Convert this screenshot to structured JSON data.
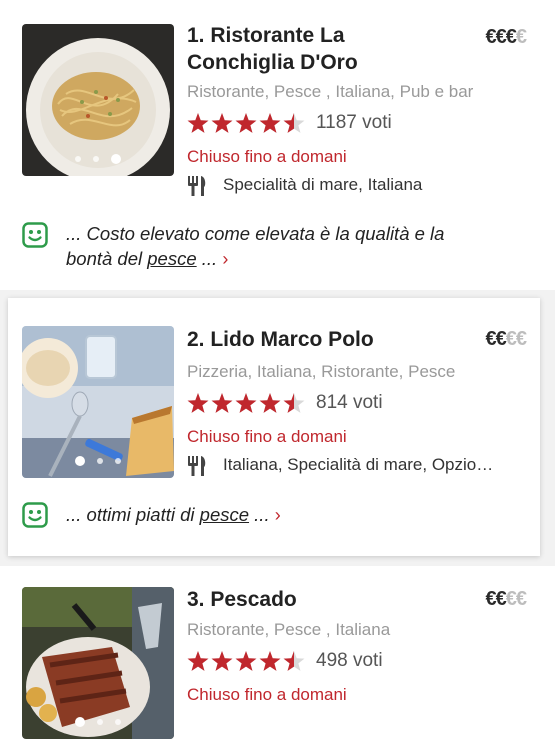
{
  "colors": {
    "accent": "#c0272d",
    "star": "#c0272d",
    "smiley": "#2e9b4a"
  },
  "restaurants": [
    {
      "name_line1": "1. Ristorante La",
      "name_line2": "Conchiglia D'Oro",
      "price_on": "€€€",
      "price_off": "€",
      "tags": "Ristorante, Pesce , Italiana, Pub e bar",
      "rating": 4.5,
      "votes": "1187 voti",
      "status": "Chiuso fino a domani",
      "cuisine": "Specialità di mare, Italiana",
      "cuisine_icon": "fork-knife-icon",
      "review_line1": "... Costo elevato come elevata è la qualità e la",
      "review_line2_pre": "bontà del ",
      "review_keyword": "pesce",
      "review_line2_post": " ...",
      "review_chevron": "›",
      "photo_index": 3,
      "photo_count": 3
    },
    {
      "name_line1": "2. Lido Marco Polo",
      "price_on": "€€",
      "price_off": "€€",
      "tags": "Pizzeria, Italiana, Ristorante, Pesce",
      "rating": 4.5,
      "votes": "814 voti",
      "status": "Chiuso fino a domani",
      "cuisine": "Italiana, Specialità di mare, Opzio…",
      "cuisine_icon": "fork-knife-icon",
      "review_line1_pre": "... ottimi piatti di ",
      "review_keyword": "pesce",
      "review_line1_post": " ...",
      "review_chevron": "›",
      "photo_index": 1,
      "photo_count": 3
    },
    {
      "name_line1": "3. Pescado",
      "price_on": "€€",
      "price_off": "€€",
      "tags": "Ristorante, Pesce , Italiana",
      "rating": 4.5,
      "votes": "498 voti",
      "status": "Chiuso fino a domani",
      "photo_index": 1,
      "photo_count": 3
    }
  ]
}
